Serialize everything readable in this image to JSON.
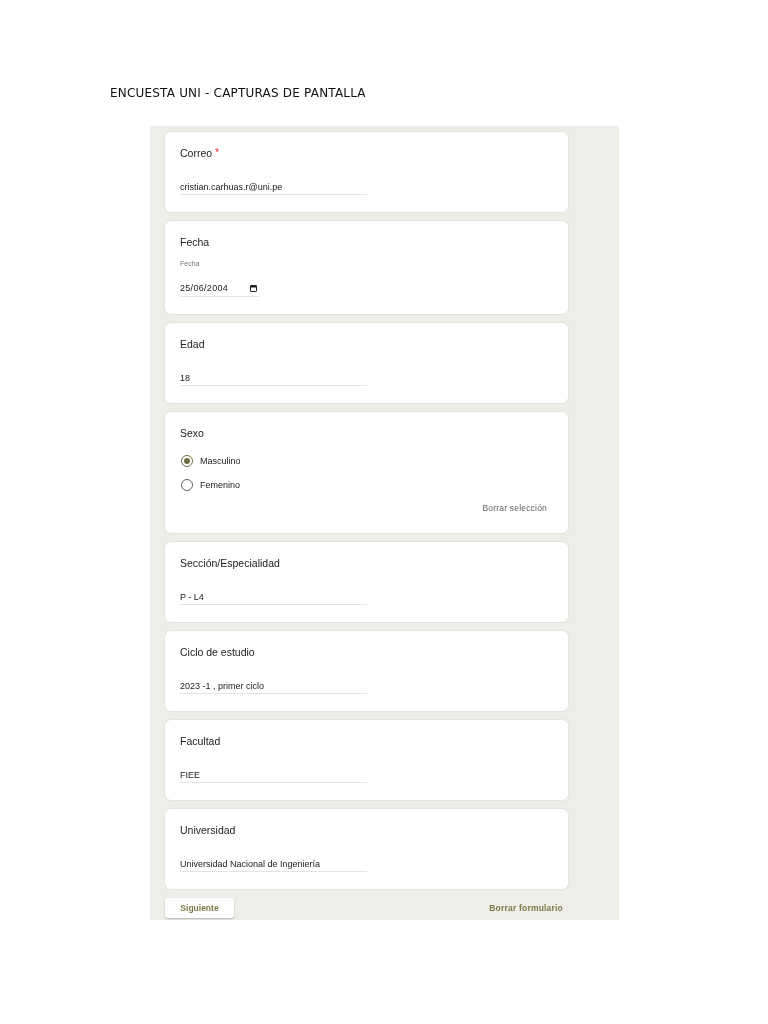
{
  "title": "ENCUESTA UNI - CAPTURAS DE PANTALLA",
  "questions": [
    {
      "kind": "text",
      "label": "Correo",
      "required_mark": "*",
      "value": "cristian.carhuas.r@uni.pe"
    },
    {
      "kind": "date",
      "label": "Fecha",
      "field_label": "Fecha",
      "value": "25/06/2004"
    },
    {
      "kind": "text",
      "label": "Edad",
      "value": "18"
    },
    {
      "kind": "radio",
      "label": "Sexo",
      "options": [
        {
          "label": "Masculino",
          "selected": true
        },
        {
          "label": "Femenino",
          "selected": false
        }
      ],
      "clear_button": "Borrar selección"
    },
    {
      "kind": "text",
      "label": "Sección/Especialidad",
      "value": "P - L4"
    },
    {
      "kind": "text",
      "label": "Ciclo de estudio",
      "value": "2023 -1 , primer ciclo"
    },
    {
      "kind": "text",
      "label": "Facultad",
      "value": "FIEE"
    },
    {
      "kind": "text",
      "label": "Universidad",
      "value": "Universidad Nacional de Ingeniería"
    }
  ],
  "footer": {
    "next_button": "Siguiente",
    "clear_form_button": "Borrar formulario"
  }
}
